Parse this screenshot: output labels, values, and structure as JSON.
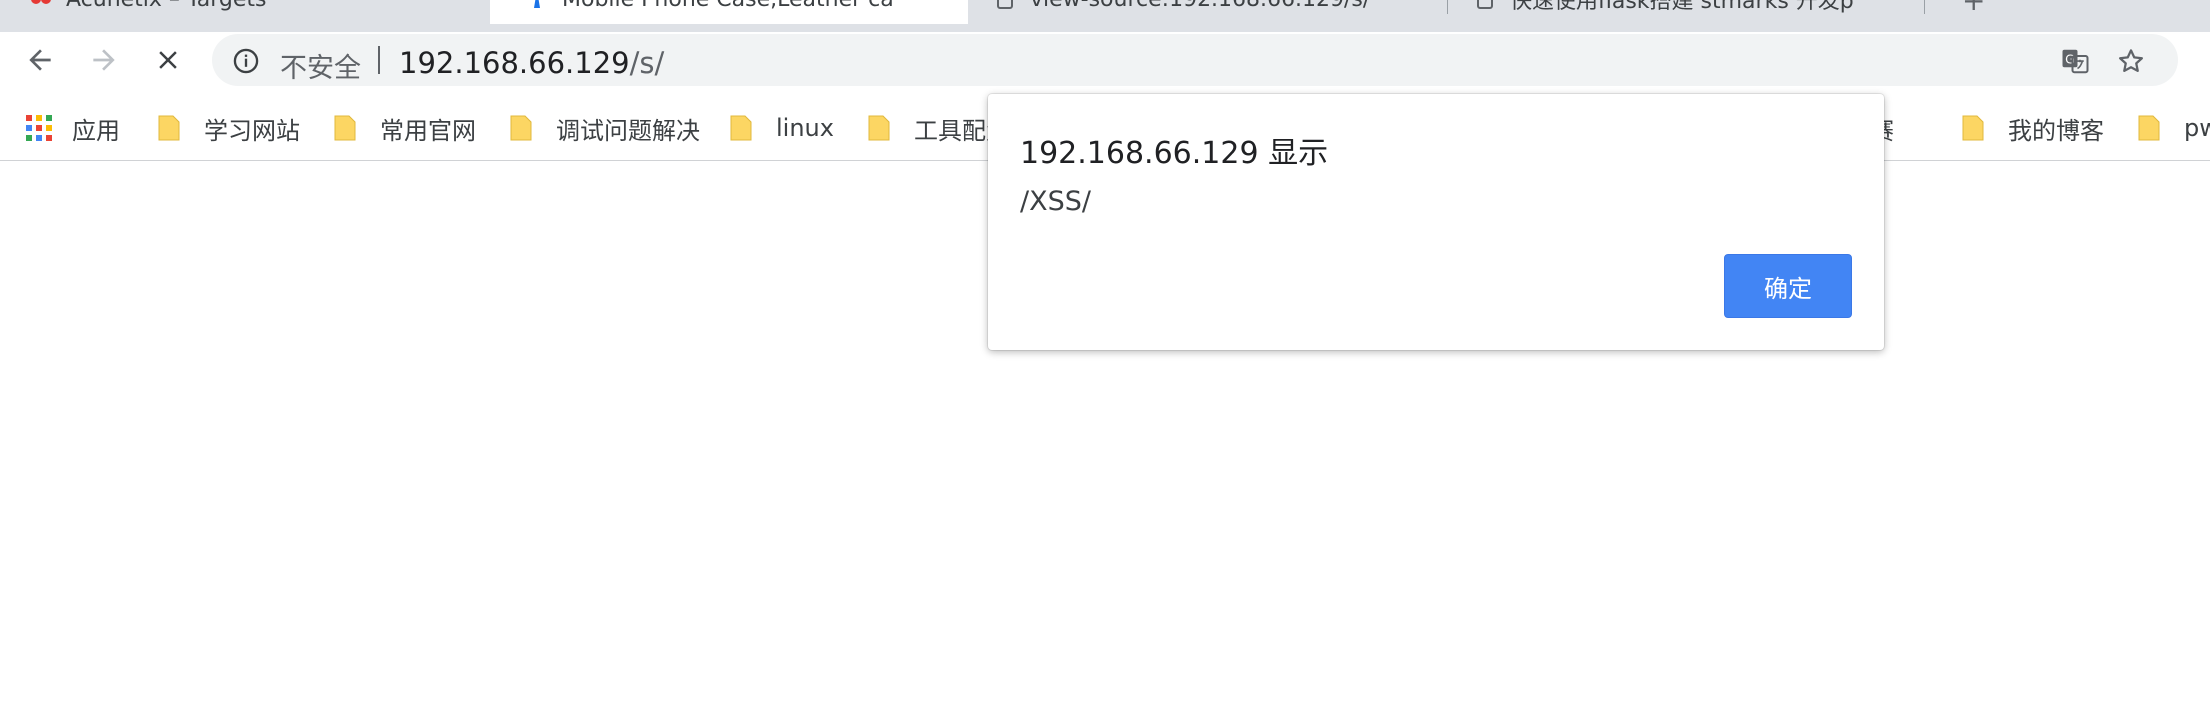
{
  "tabs": [
    {
      "label": "Acunetix – Targets",
      "active": false,
      "favicon_color": "#e53935"
    },
    {
      "label": "Mobile Phone Case,Leather ca",
      "active": true,
      "favicon_color": "#1a73e8"
    },
    {
      "label": "view-source:192.168.66.129/s/",
      "active": false,
      "favicon_color": "#5f6368"
    },
    {
      "label": "快速使用flask搭建 stmarks 开发p",
      "active": false,
      "favicon_color": "#5f6368"
    }
  ],
  "toolbar": {
    "security_label": "不安全",
    "url_host": "192.168.66.129",
    "url_path": "/s/",
    "back_icon": "arrow-left-icon",
    "forward_icon": "arrow-right-icon",
    "stop_icon": "close-icon"
  },
  "bookmarks": {
    "apps_label": "应用",
    "items": [
      {
        "label": "学习网站"
      },
      {
        "label": "常用官网"
      },
      {
        "label": "调试问题解决"
      },
      {
        "label": "linux"
      },
      {
        "label": "工具配置"
      },
      {
        "label": "比赛"
      },
      {
        "label": "我的博客"
      },
      {
        "label": "pwn"
      }
    ]
  },
  "dialog": {
    "title": "192.168.66.129 显示",
    "message": "/XSS/",
    "ok_label": "确定"
  },
  "colors": {
    "accent": "#4285f4",
    "folder": "#fcd663",
    "tabstrip": "#dee1e6"
  }
}
